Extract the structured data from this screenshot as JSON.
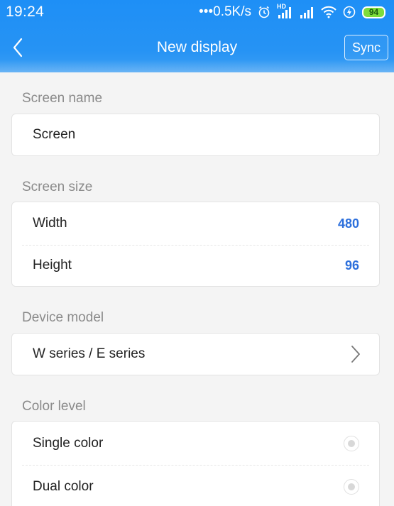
{
  "status_bar": {
    "time": "19:24",
    "network_speed": "0.5K/s",
    "hd_label": "HD",
    "battery_level": "94",
    "icons": [
      "alarm-icon",
      "hd-signal-icon",
      "signal-icon",
      "wifi-icon",
      "charging-icon",
      "battery-icon"
    ]
  },
  "nav": {
    "title": "New display",
    "back_icon": "chevron-left-icon",
    "sync_label": "Sync"
  },
  "screen_name": {
    "label": "Screen name",
    "value": "Screen"
  },
  "screen_size": {
    "label": "Screen size",
    "width_label": "Width",
    "width_value": "480",
    "height_label": "Height",
    "height_value": "96"
  },
  "device_model": {
    "label": "Device model",
    "value": "W series / E series",
    "arrow_icon": "chevron-right-icon"
  },
  "color_level": {
    "label": "Color level",
    "options": [
      {
        "label": "Single color",
        "selected": false
      },
      {
        "label": "Dual color",
        "selected": false
      }
    ]
  },
  "colors": {
    "header_blue": "#2693f4",
    "value_blue": "#2c6fdc",
    "background": "#f4f4f4",
    "label_gray": "#8a8a8a"
  }
}
